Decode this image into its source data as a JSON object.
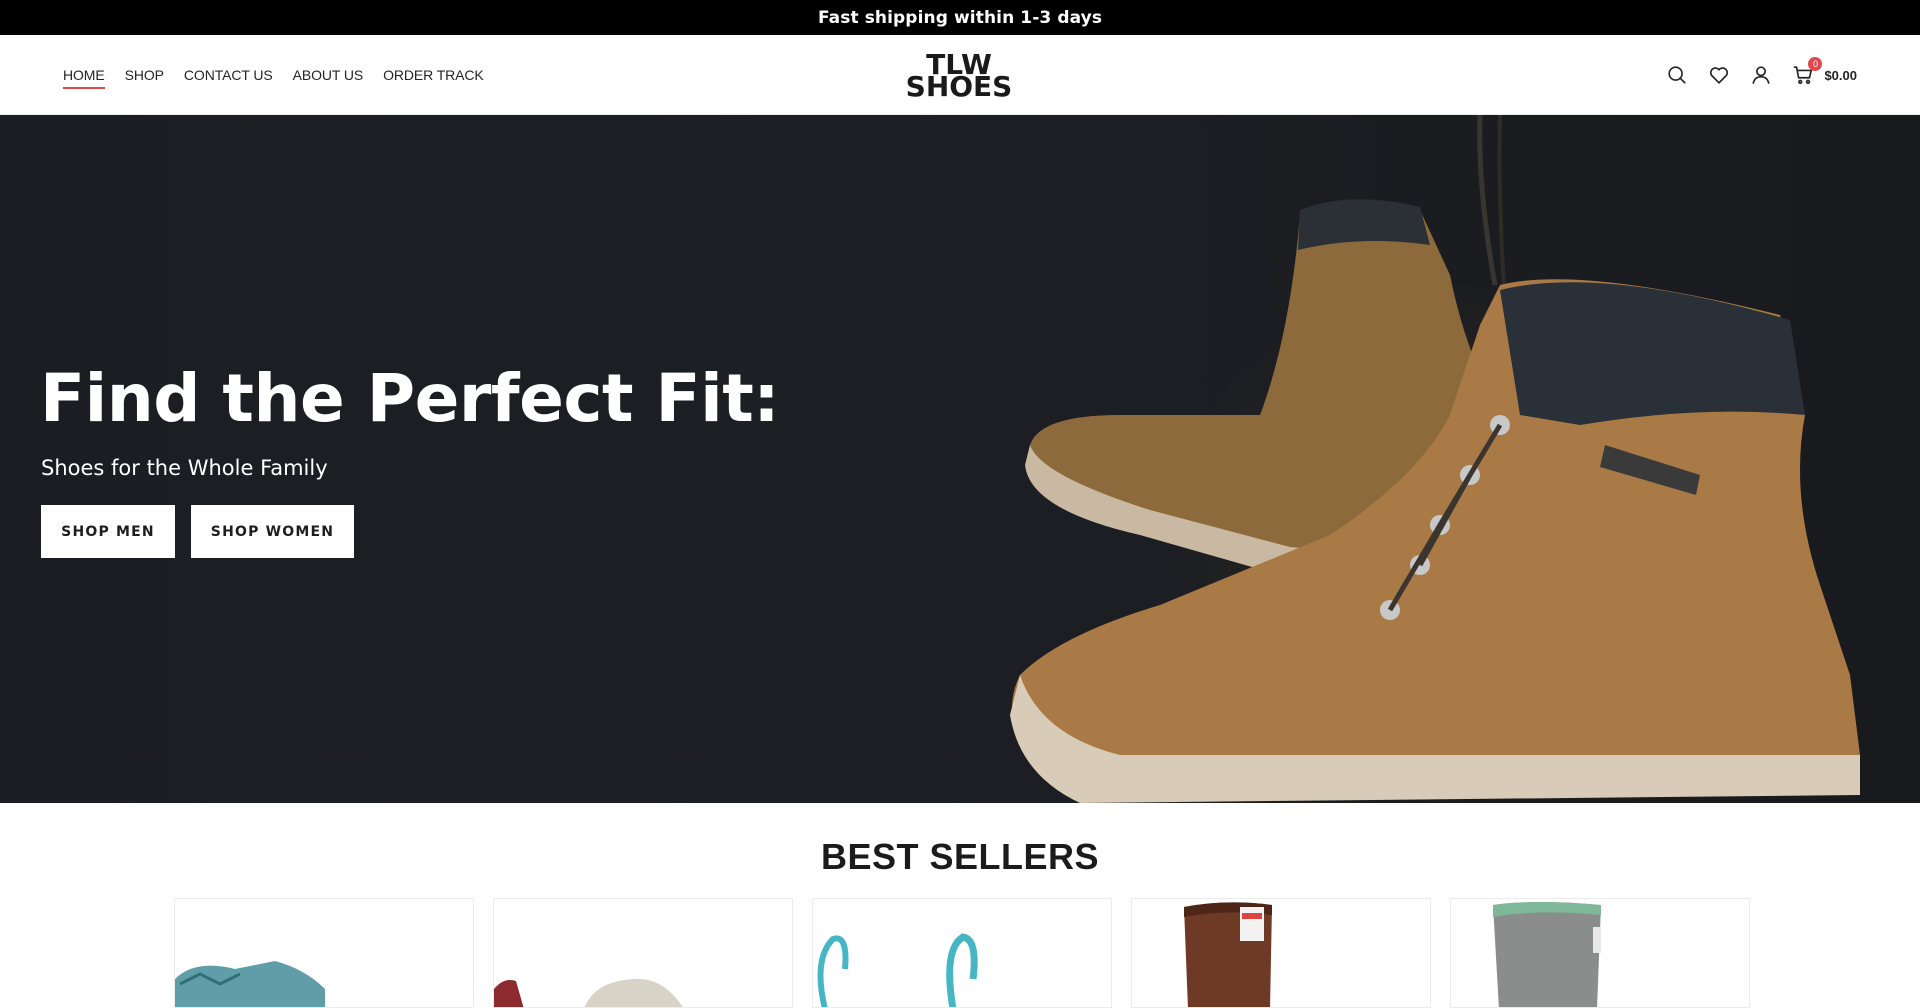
{
  "topbar": {
    "text": "Fast shipping within 1-3 days"
  },
  "nav": {
    "items": [
      {
        "label": "HOME",
        "active": true
      },
      {
        "label": "SHOP",
        "active": false
      },
      {
        "label": "CONTACT US",
        "active": false
      },
      {
        "label": "ABOUT US",
        "active": false
      },
      {
        "label": "ORDER TRACK",
        "active": false
      }
    ]
  },
  "logo": {
    "line1": "TLW",
    "line2": "SHOES"
  },
  "header_icons": {
    "search": "search-icon",
    "wishlist": "heart-icon",
    "account": "user-icon",
    "cart": "cart-icon",
    "cart_count": "0",
    "cart_total": "$0.00"
  },
  "hero": {
    "title": "Find the Perfect Fit:",
    "subtitle": "Shoes for the Whole Family",
    "buttons": {
      "men": "SHOP MEN",
      "women": "SHOP WOMEN"
    }
  },
  "bestsellers": {
    "title": "BEST SELLERS",
    "products": [
      {
        "image": "teal-patterned-sandal"
      },
      {
        "image": "grey-sneaker"
      },
      {
        "image": "teal-strap-sandal"
      },
      {
        "image": "brown-rubber-boot"
      },
      {
        "image": "grey-rubber-boot"
      }
    ]
  },
  "colors": {
    "accent": "#e0484a",
    "topbar_bg": "#000000",
    "text": "#242424"
  }
}
